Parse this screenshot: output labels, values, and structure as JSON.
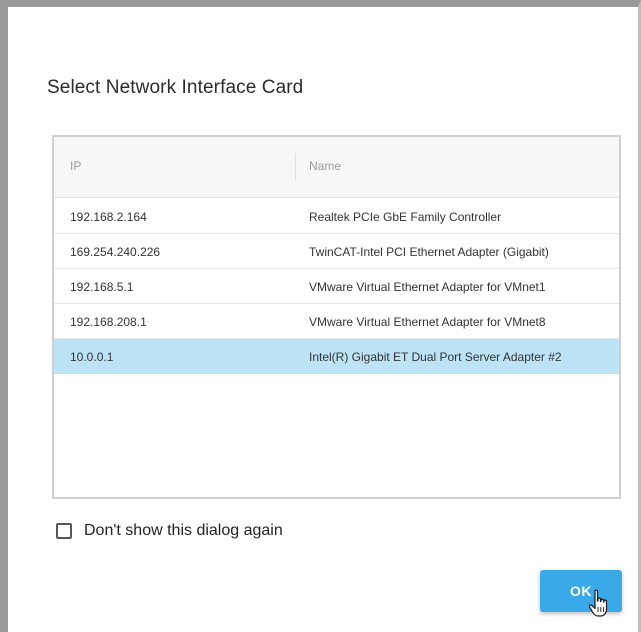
{
  "dialog": {
    "title": "Select Network Interface Card"
  },
  "table": {
    "columns": [
      "IP",
      "Name"
    ],
    "rows": [
      {
        "ip": "192.168.2.164",
        "name": "Realtek PCIe GbE Family Controller",
        "selected": false
      },
      {
        "ip": "169.254.240.226",
        "name": "TwinCAT-Intel PCI Ethernet Adapter (Gigabit)",
        "selected": false
      },
      {
        "ip": "192.168.5.1",
        "name": "VMware Virtual Ethernet Adapter for VMnet1",
        "selected": false
      },
      {
        "ip": "192.168.208.1",
        "name": "VMware Virtual Ethernet Adapter for VMnet8",
        "selected": false
      },
      {
        "ip": "10.0.0.1",
        "name": "Intel(R) Gigabit ET Dual Port Server Adapter #2",
        "selected": true
      }
    ]
  },
  "options": {
    "dont_show_label": "Don't show this dialog again",
    "dont_show_checked": false
  },
  "buttons": {
    "ok_label": "OK"
  },
  "colors": {
    "accent": "#3aa9e8",
    "selected_row": "#bde3f7"
  },
  "icons": {
    "cursor": "hand-pointer-icon"
  }
}
